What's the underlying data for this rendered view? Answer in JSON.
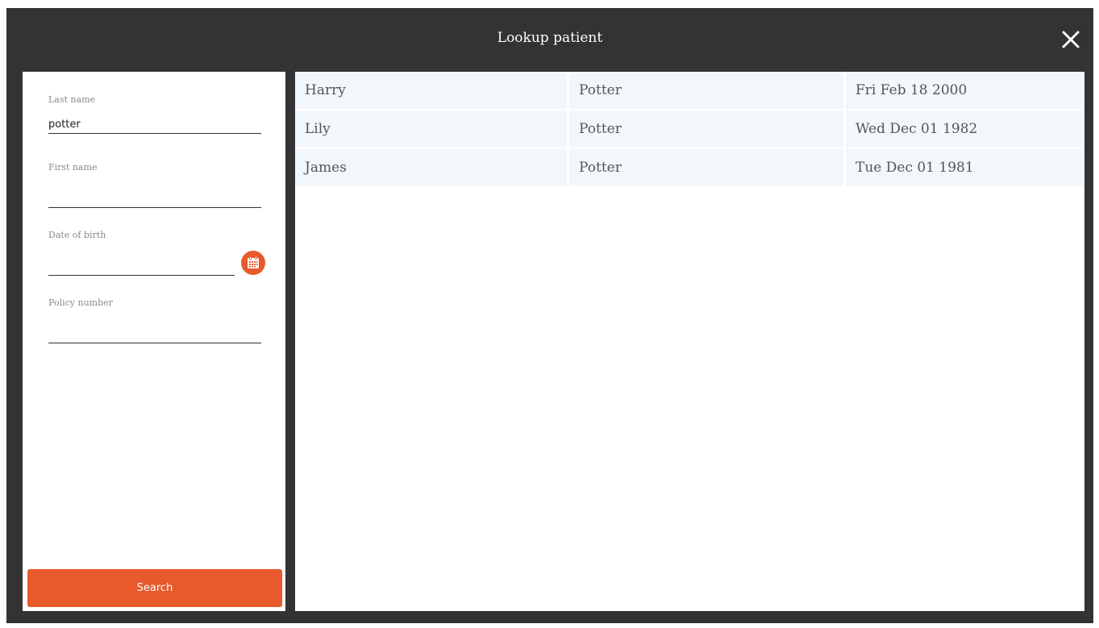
{
  "dialog": {
    "title": "Lookup patient",
    "close_icon": "close-icon"
  },
  "search_form": {
    "last_name": {
      "label": "Last name",
      "value": "potter",
      "placeholder": ""
    },
    "first_name": {
      "label": "First name",
      "value": "",
      "placeholder": ""
    },
    "date_of_birth": {
      "label": "Date of birth",
      "value": "",
      "placeholder": "",
      "icon": "calendar-icon"
    },
    "policy_number": {
      "label": "Policy number",
      "value": "",
      "placeholder": ""
    },
    "search_label": "Search"
  },
  "results": [
    {
      "first_name": "Harry",
      "last_name": "Potter",
      "date_of_birth": "Fri Feb 18 2000"
    },
    {
      "first_name": "Lily",
      "last_name": "Potter",
      "date_of_birth": "Wed Dec 01 1982"
    },
    {
      "first_name": "James",
      "last_name": "Potter",
      "date_of_birth": "Tue Dec 01 1981"
    }
  ],
  "colors": {
    "dialog_background": "#333333",
    "accent": "#e8592b",
    "row_background": "#f2f7fc"
  }
}
